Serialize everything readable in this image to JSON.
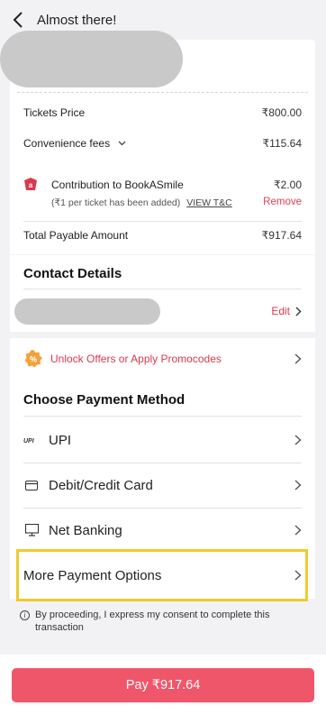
{
  "header": {
    "title": "Almost there!"
  },
  "summary": {
    "tickets_label": "Tickets Price",
    "tickets_amount": "₹800.00",
    "fees_label": "Convenience fees",
    "fees_amount": "₹115.64",
    "contribution_title": "Contribution to BookASmile",
    "contribution_amount": "₹2.00",
    "contribution_note": "(₹1 per ticket has been added)",
    "contribution_link": "VIEW T&C",
    "remove_label": "Remove",
    "total_label": "Total Payable Amount",
    "total_amount": "₹917.64"
  },
  "contact": {
    "title": "Contact Details",
    "edit_label": "Edit"
  },
  "promo": {
    "label": "Unlock Offers or Apply Promocodes"
  },
  "payment": {
    "title": "Choose Payment Method",
    "options": [
      {
        "label": "UPI",
        "icon": "upi-icon"
      },
      {
        "label": "Debit/Credit Card",
        "icon": "card-icon"
      },
      {
        "label": "Net Banking",
        "icon": "monitor-icon"
      },
      {
        "label": "More Payment Options",
        "icon": ""
      }
    ]
  },
  "consent": {
    "text": "By proceeding, I express my consent to complete this transaction"
  },
  "pay_button": {
    "label": "Pay ₹917.64"
  },
  "colors": {
    "accent": "#f0566a",
    "link_red": "#d83a4d",
    "highlight": "#f1ca2c",
    "promo_icon": "#f2a23a"
  }
}
